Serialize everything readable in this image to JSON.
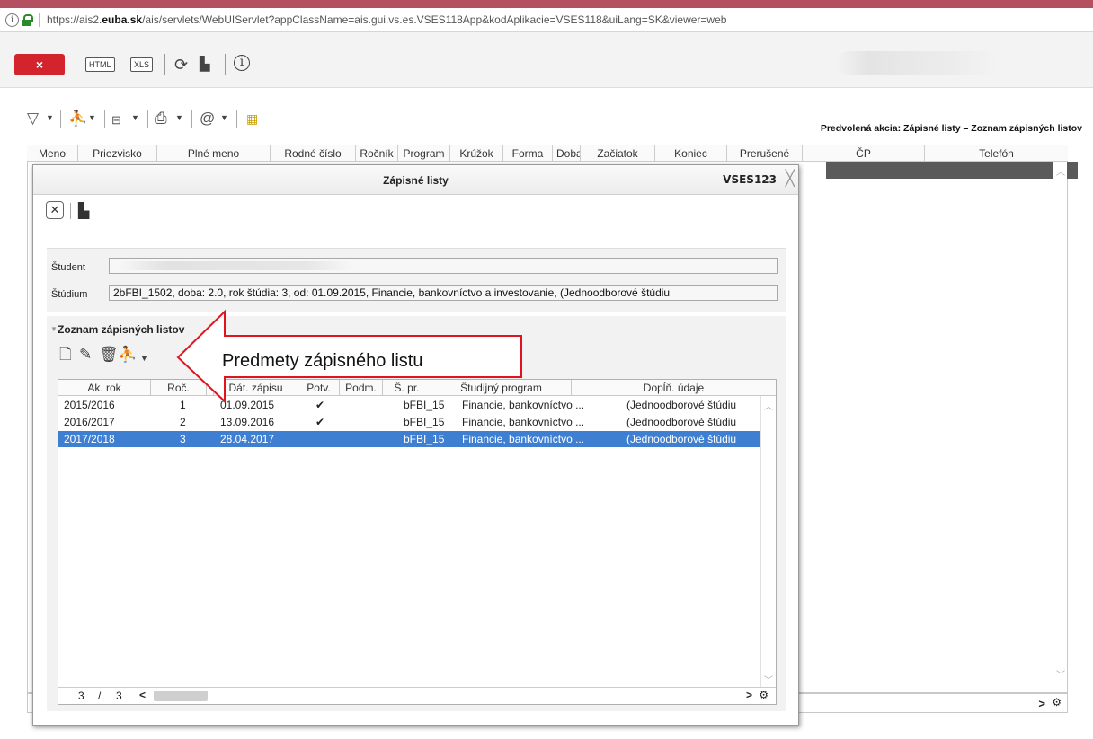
{
  "browser": {
    "url_prefix": "https://ais2.",
    "url_domain": "euba.sk",
    "url_suffix": "/ais/servlets/WebUIServlet?appClassName=ais.gui.vs.es.VSES118App&kodAplikacie=VSES118&uiLang=SK&viewer=web"
  },
  "app_toolbar": {
    "close_label": "×",
    "html_label": "HTML",
    "xls_label": "XLS",
    "info_label": "i"
  },
  "main_toolbar": {
    "default_action": "Predvolená akcia: Zápisné listy – Zoznam zápisných listov"
  },
  "main_grid": {
    "columns": [
      "Meno",
      "Priezvisko",
      "Plné meno",
      "Rodné číslo",
      "Ročník",
      "Program",
      "Krúžok",
      "Forma",
      "Doba",
      "Začiatok",
      "Koniec",
      "Prerušené",
      "ČP",
      "Telefón"
    ],
    "footer_next": ">"
  },
  "dialog": {
    "title": "Zápisné listy",
    "code": "VSES123",
    "student_label": "Študent",
    "student_value": "",
    "study_label": "Štúdium",
    "study_value": "2bFBI_1502, doba: 2.0, rok štúdia: 3, od: 01.09.2015, Financie, bankovníctvo a investovanie, (Jednoodborové štúdiu",
    "list_title": "Zoznam zápisných listov",
    "table": {
      "columns": [
        "Ak. rok",
        "Roč.",
        "",
        "Dát. zápisu",
        "Potv.",
        "Podm.",
        "Š. pr.",
        "Študijný program",
        "Dopĺň. údaje"
      ],
      "rows": [
        {
          "year": "2015/2016",
          "roc": "1",
          "date": "01.09.2015",
          "potv": "✔",
          "podm": "",
          "spr": "bFBI_15",
          "program": "Financie, bankovníctvo ...",
          "extra": "(Jednoodborové štúdiu"
        },
        {
          "year": "2016/2017",
          "roc": "2",
          "date": "13.09.2016",
          "potv": "✔",
          "podm": "",
          "spr": "bFBI_15",
          "program": "Financie, bankovníctvo ...",
          "extra": "(Jednoodborové štúdiu"
        },
        {
          "year": "2017/2018",
          "roc": "3",
          "date": "28.04.2017",
          "potv": "",
          "podm": "",
          "spr": "bFBI_15",
          "program": "Financie, bankovníctvo ...",
          "extra": "(Jednoodborové štúdiu"
        }
      ],
      "footer_current": "3",
      "footer_slash": "/",
      "footer_total": "3",
      "footer_prev": "<",
      "footer_next": ">"
    }
  },
  "callout": {
    "text": "Predmety zápisného listu",
    "stroke_color": "#e0141e"
  },
  "colors": {
    "top_bar": "#b4505f",
    "close_button": "#d3242d",
    "selected_row": "#3f7fd2"
  }
}
